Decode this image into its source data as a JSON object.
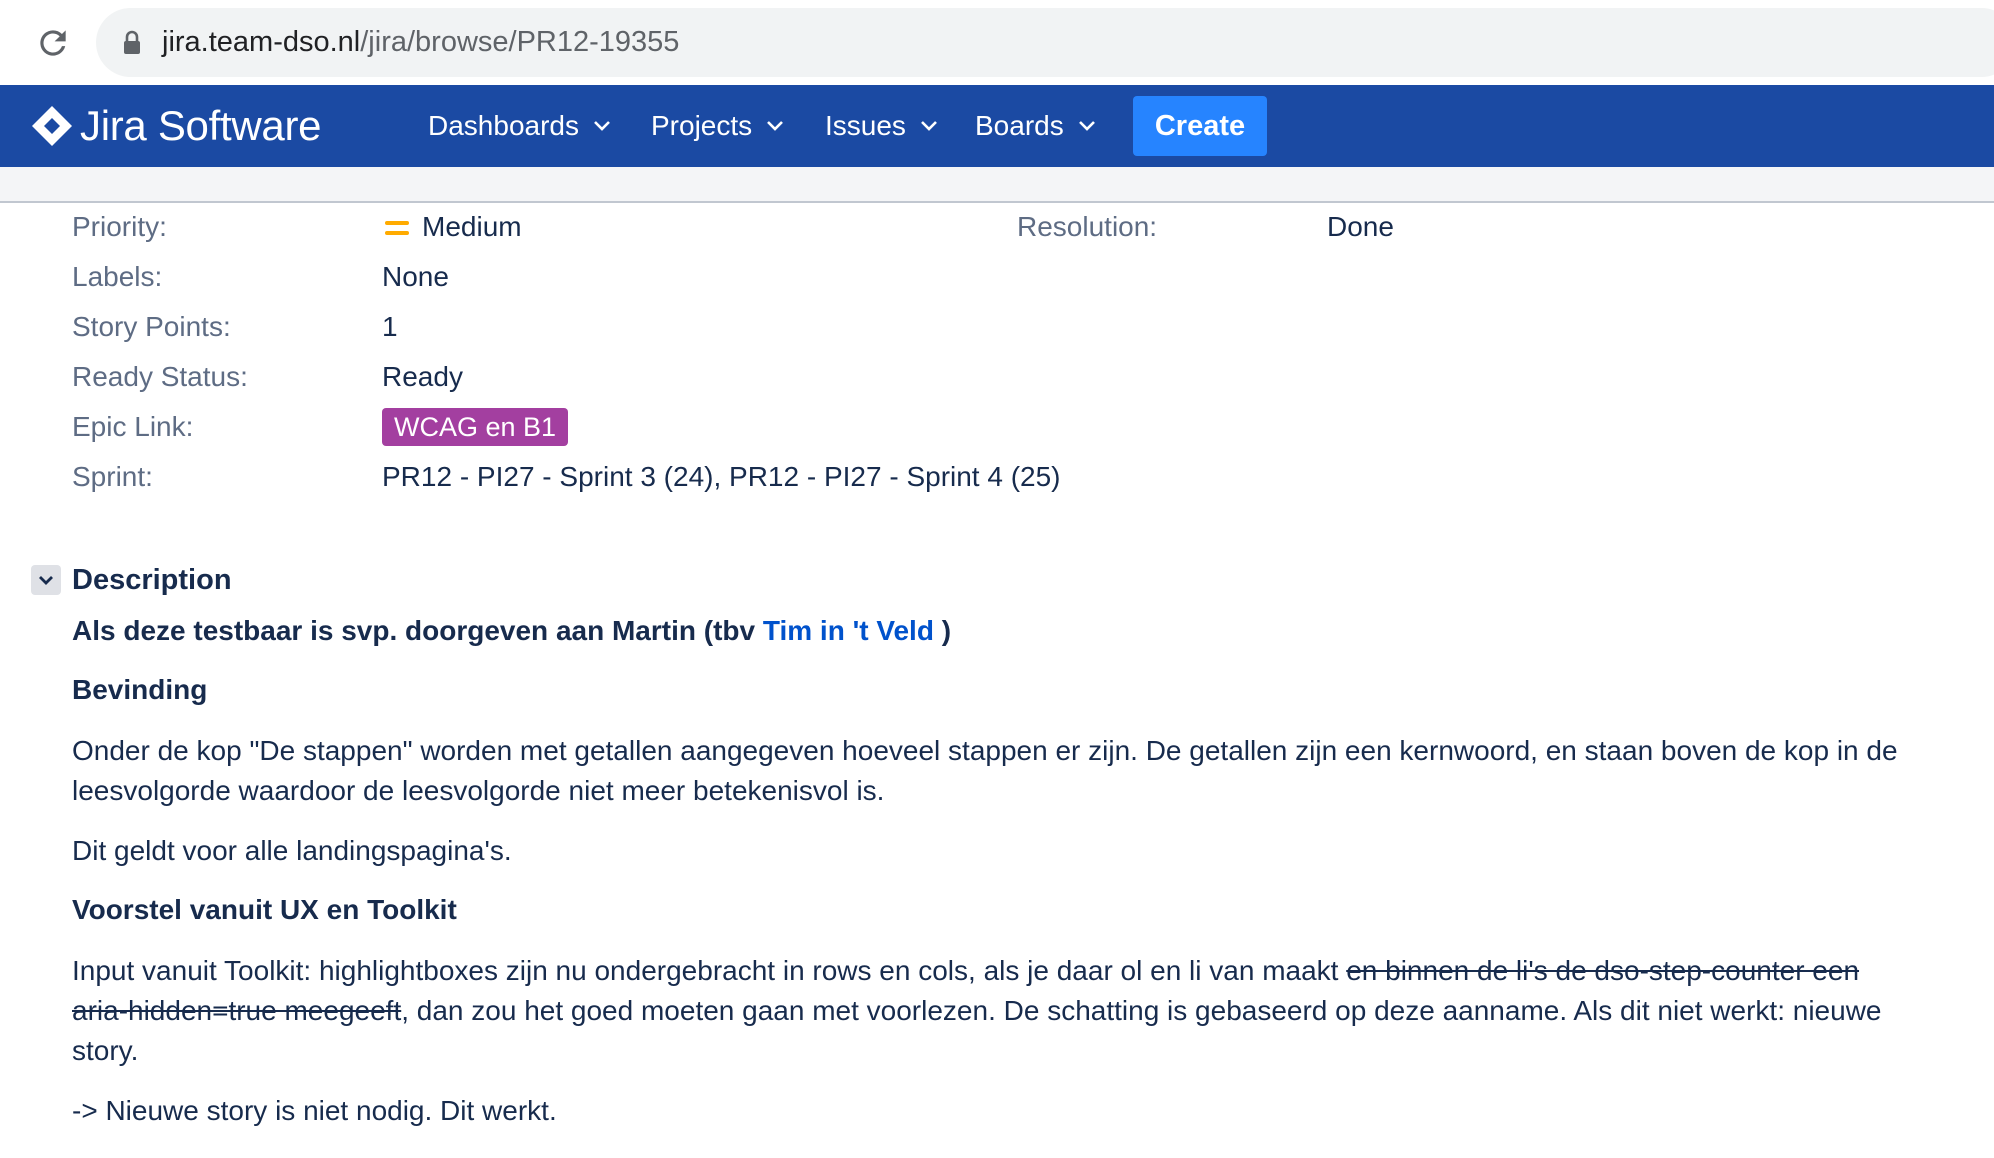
{
  "browser": {
    "url_host": "jira.team-dso.nl",
    "url_path": "/jira/browse/PR12-19355"
  },
  "nav": {
    "app_title": "Jira Software",
    "items": [
      "Dashboards",
      "Projects",
      "Issues",
      "Boards"
    ],
    "create_label": "Create",
    "colors": {
      "nav_bg": "#1b4aa3",
      "create_bg": "#2684ff"
    }
  },
  "details": {
    "priority_label": "Priority:",
    "priority_value": "Medium",
    "resolution_label": "Resolution:",
    "resolution_value": "Done",
    "labels_label": "Labels:",
    "labels_value": "None",
    "story_points_label": "Story Points:",
    "story_points_value": "1",
    "ready_status_label": "Ready Status:",
    "ready_status_value": "Ready",
    "epic_link_label": "Epic Link:",
    "epic_link_value": "WCAG en B1",
    "sprint_label": "Sprint:",
    "sprint_value": "PR12 - PI27 - Sprint 3 (24), PR12 - PI27 - Sprint 4 (25)",
    "colors": {
      "priority_icon": "#ffab00",
      "epic_bg": "#a33fa0"
    }
  },
  "description": {
    "title": "Description",
    "intro_text": "Als deze testbaar is svp. doorgeven aan Martin (tbv ",
    "intro_mention": "Tim in 't Veld",
    "intro_end": " )",
    "heading_bevinding": "Bevinding",
    "bevinding_text": "Onder de kop \"De stappen\" worden met getallen aangegeven hoeveel stappen er zijn. De getallen zijn een kernwoord, en staan boven de kop in de leesvolgorde waardoor de leesvolgorde niet meer betekenisvol is.",
    "applies_text": "Dit geldt voor alle landingspagina's.",
    "heading_voorstel": "Voorstel vanuit UX en Toolkit",
    "voorstel_text_1": "Input vanuit Toolkit: highlightboxes zijn nu ondergebracht in rows en cols, als je daar ol en li van maakt ",
    "voorstel_strike": "en binnen de li's de dso-step-counter een aria-hidden=true meegeeft",
    "voorstel_text_2": ", dan zou het goed moeten gaan met voorlezen. De schatting is gebaseerd op deze aanname. Als dit niet werkt: nieuwe story.",
    "conclusion_text": "-> Nieuwe story is niet nodig. Dit werkt."
  }
}
